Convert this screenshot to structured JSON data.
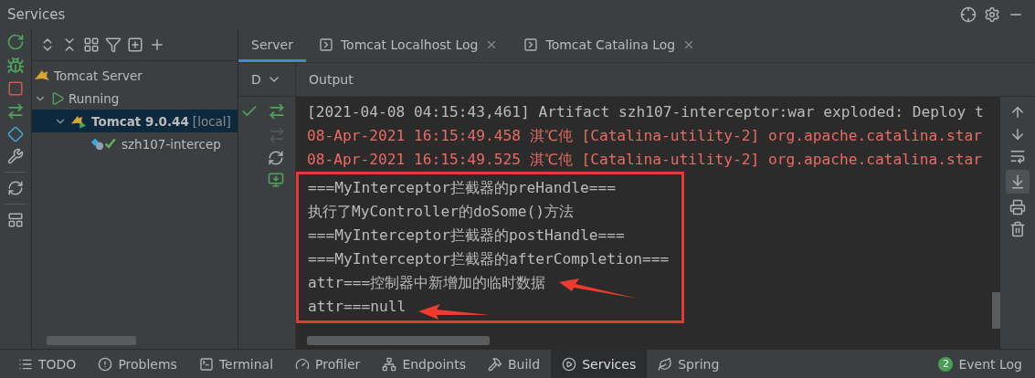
{
  "window": {
    "title": "Services"
  },
  "tree": [
    {
      "label": "Tomcat Server",
      "kind": "server",
      "selected": false,
      "children": [
        {
          "label": "Running",
          "kind": "group",
          "expanded": true,
          "selected": false,
          "children": [
            {
              "label": "Tomcat 9.0.44",
              "suffix": "[local]",
              "kind": "instance",
              "expanded": true,
              "selected": true,
              "children": [
                {
                  "label": "szh107-intercep",
                  "kind": "artifact",
                  "selected": false
                }
              ]
            }
          ]
        }
      ]
    }
  ],
  "tabs": [
    {
      "label": "Server",
      "selected": true,
      "closable": false
    },
    {
      "label": "Tomcat Localhost Log",
      "selected": false,
      "closable": true
    },
    {
      "label": "Tomcat Catalina Log",
      "selected": false,
      "closable": true
    }
  ],
  "deploy_dropdown": "D",
  "output_label": "Output",
  "log": [
    {
      "kind": "info",
      "text": "[2021-04-08 04:15:43,461] Artifact szh107-interceptor:war exploded: Deploy t"
    },
    {
      "kind": "error",
      "text": "08-Apr-2021 16:15:49.458 淇℃伅 [Catalina-utility-2] org.apache.catalina.star"
    },
    {
      "kind": "error",
      "text": "08-Apr-2021 16:15:49.525 淇℃伅 [Catalina-utility-2] org.apache.catalina.star"
    }
  ],
  "highlighted_log": [
    {
      "text": "===MyInterceptor拦截器的preHandle===",
      "arrow": false
    },
    {
      "text": "执行了MyController的doSome()方法",
      "arrow": false
    },
    {
      "text": "===MyInterceptor拦截器的postHandle===",
      "arrow": false
    },
    {
      "text": "===MyInterceptor拦截器的afterCompletion===",
      "arrow": false
    },
    {
      "text": "attr===控制器中新增加的临时数据",
      "arrow": true
    },
    {
      "text": "attr===null",
      "arrow": true
    }
  ],
  "status_bar": [
    {
      "label": "TODO",
      "selected": false
    },
    {
      "label": "Problems",
      "selected": false
    },
    {
      "label": "Terminal",
      "selected": false
    },
    {
      "label": "Profiler",
      "selected": false
    },
    {
      "label": "Endpoints",
      "selected": false
    },
    {
      "label": "Build",
      "selected": false
    },
    {
      "label": "Services",
      "selected": true
    },
    {
      "label": "Spring",
      "selected": false
    }
  ],
  "event_log": {
    "label": "Event Log",
    "count": "2"
  }
}
